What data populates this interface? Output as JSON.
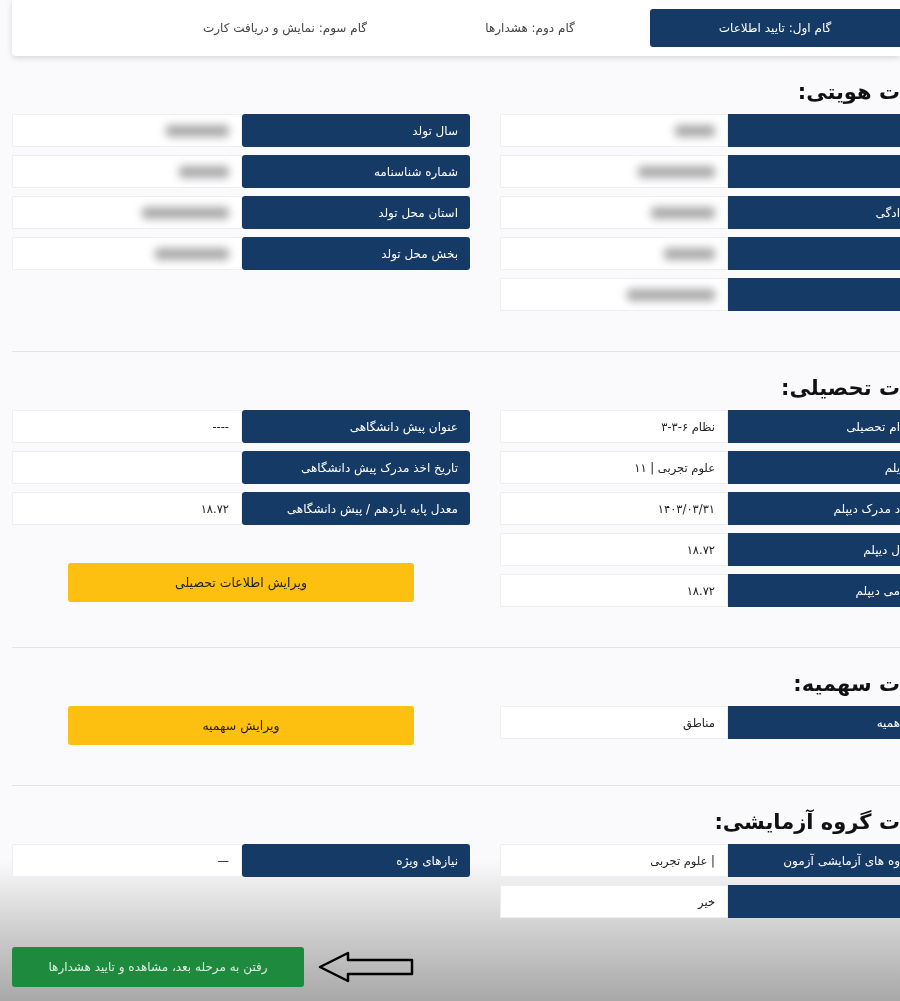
{
  "steps": [
    {
      "label": "گام اول: تایید اطلاعات",
      "selected": true
    },
    {
      "label": "گام دوم: هشدارها",
      "selected": false
    },
    {
      "label": "گام سوم: نمایش و دریافت کارت",
      "selected": false
    }
  ],
  "sections": [
    {
      "title": "ت هویتی:",
      "columns": [
        [
          {
            "blurred": true
          },
          {
            "blurred": true
          },
          {
            "label": "ادگی",
            "blurred": true
          },
          {
            "blurred": true
          },
          {
            "blurred": true
          }
        ],
        [
          {
            "label": "سال تولد",
            "blurred": true
          },
          {
            "label": "شماره شناسنامه",
            "blurred": true
          },
          {
            "label": "استان محل تولد",
            "blurred": true
          },
          {
            "label": "بخش محل تولد",
            "blurred": true
          }
        ]
      ]
    },
    {
      "title": "ت تحصیلی:",
      "columns": [
        [
          {
            "label": "ام تحصیلی",
            "value": "نظام ۶-۳-۳",
            "blurred": false
          },
          {
            "label": "یلم",
            "value": "علوم تجربی | ۱۱",
            "blurred": false
          },
          {
            "label": "د مدرک دیپلم",
            "value": "۱۴۰۳/۰۳/۳۱",
            "blurred": false
          },
          {
            "label": "ل دیپلم",
            "value": "۱۸.۷۲",
            "blurred": false
          },
          {
            "label": "می دیپلم",
            "value": "۱۸.۷۲",
            "blurred": false
          }
        ],
        [
          {
            "label": "عنوان پیش دانشگاهی",
            "value": "----",
            "blurred": false
          },
          {
            "label": "تاریخ اخذ مدرک پیش دانشگاهی",
            "blurred": false
          },
          {
            "label": "معدل پایه یازدهم / پیش دانشگاهی",
            "value": "۱۸.۷۲",
            "blurred": false
          }
        ]
      ],
      "buttons": [
        "ویرایش اطلاعات تحصیلی"
      ]
    },
    {
      "title": "ت سهمیه:",
      "columns": [
        [
          {
            "label": "همیه",
            "value": "مناطق",
            "blurred": false
          }
        ],
        []
      ],
      "buttons": [
        "ویرایش سهمیه"
      ]
    },
    {
      "title": "ت گروه آزمایشی:",
      "columns": [
        [
          {
            "label": "وه های آزمایشی آزمون",
            "value": "| علوم تجربی",
            "blurred": false
          },
          {
            "value": "خیر",
            "blurred": false
          }
        ],
        [
          {
            "label": "نیازهای ویژه",
            "value": "—",
            "blurred": false
          }
        ]
      ]
    }
  ],
  "next_button": "رفتن به مرحله بعد، مشاهده و تایید هشدارها"
}
